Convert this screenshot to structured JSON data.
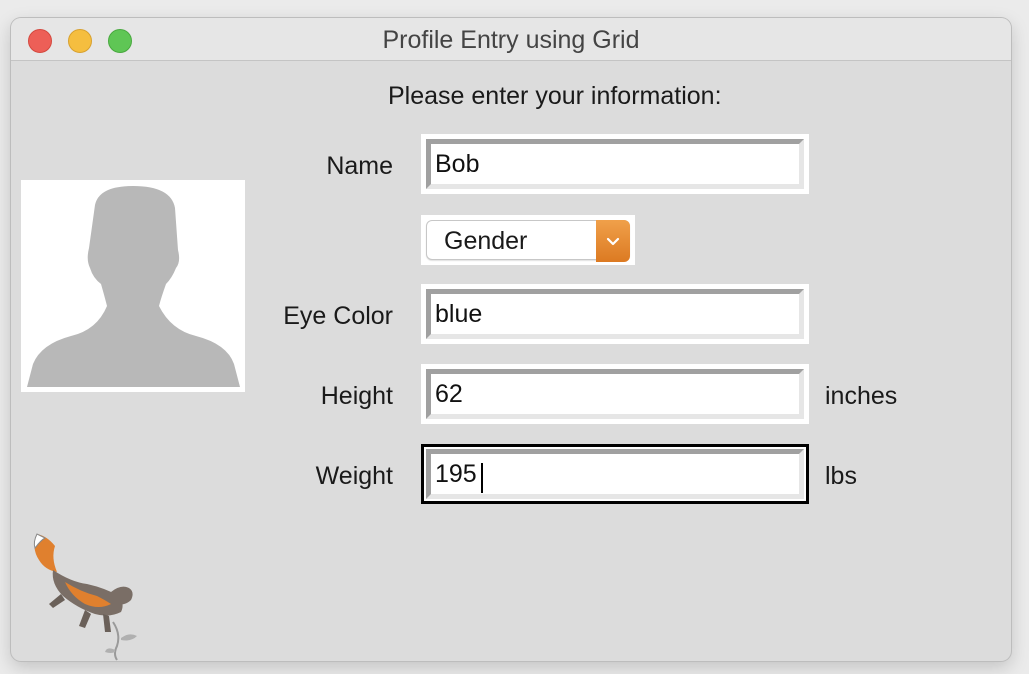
{
  "window": {
    "title": "Profile Entry using Grid"
  },
  "form": {
    "prompt": "Please enter your information:",
    "name": {
      "label": "Name",
      "value": "Bob"
    },
    "gender": {
      "selected": "Gender"
    },
    "eye_color": {
      "label": "Eye Color",
      "value": "blue"
    },
    "height": {
      "label": "Height",
      "value": "62",
      "unit": "inches"
    },
    "weight": {
      "label": "Weight",
      "value": "195",
      "unit": "lbs"
    }
  },
  "colors": {
    "accent_dropdown": "#e08a32",
    "focus_border": "#000000"
  },
  "icons": {
    "avatar": "person-silhouette-icon",
    "mascot": "fox-mascot-icon"
  }
}
